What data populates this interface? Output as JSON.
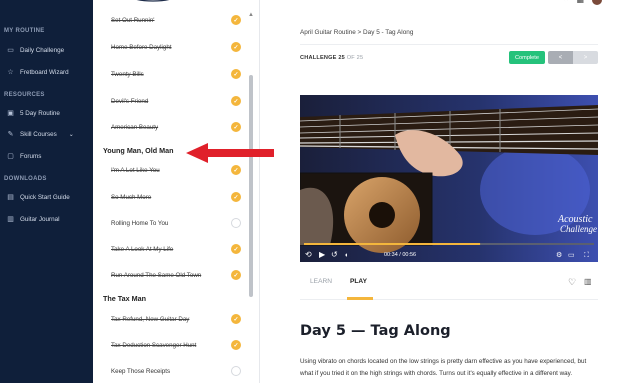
{
  "nav": {
    "sections": [
      {
        "label": "MY ROUTINE"
      },
      {
        "label": "RESOURCES"
      },
      {
        "label": "DOWNLOADS"
      }
    ],
    "items": [
      {
        "label": "Daily Challenge",
        "icon": "challenge-icon"
      },
      {
        "label": "Fretboard Wizard",
        "icon": "star-icon"
      },
      {
        "label": "5 Day Routine",
        "icon": "calendar-icon"
      },
      {
        "label": "Skill Courses",
        "icon": "courses-icon"
      },
      {
        "label": "Forums",
        "icon": "forum-icon"
      },
      {
        "label": "Quick Start Guide",
        "icon": "book-icon"
      },
      {
        "label": "Guitar Journal",
        "icon": "journal-icon"
      }
    ]
  },
  "lessons": {
    "items": [
      {
        "label": "Set Out Runnin'",
        "done": true
      },
      {
        "label": "Home Before Daylight",
        "done": true
      },
      {
        "label": "Twenty Bills",
        "done": true
      },
      {
        "label": "Devil's Friend",
        "done": true
      },
      {
        "label": "American Beauty",
        "done": true
      },
      {
        "label": "I'm A Lot Like You",
        "done": true
      },
      {
        "label": "So Much More",
        "done": true
      },
      {
        "label": "Rolling Home To You",
        "done": false
      },
      {
        "label": "Take A Look At My Life",
        "done": true
      },
      {
        "label": "Run Around The Same Old Town",
        "done": true
      },
      {
        "label": "Tax Refund, New Guitar Day",
        "done": true
      },
      {
        "label": "Tax Deduction Scavenger Hunt",
        "done": true
      },
      {
        "label": "Keep Those Receipts",
        "done": false
      }
    ],
    "groups": [
      {
        "label": "Young Man, Old Man"
      },
      {
        "label": "The Tax Man"
      }
    ]
  },
  "main": {
    "breadcrumb": "April Guitar Routine  >  Day 5 - Tag Along",
    "challenge_label": "CHALLENGE 25",
    "challenge_of": " OF 25",
    "complete_label": "Complete",
    "prev_label": "<",
    "next_label": ">",
    "video_time": "00:34 / 00:56",
    "video_watermark_1": "Acoustic",
    "video_watermark_2": "Challenge",
    "tabs": [
      {
        "label": "LEARN"
      },
      {
        "label": "PLAY"
      }
    ],
    "title": "Day 5 — Tag Along",
    "body_line1": "Using vibrato on chords located on the low strings is pretty darn effective as you have experienced, but",
    "body_line2": "what if you tried it on the high strings with chords. Turns out it's equally effective in a different way."
  },
  "colors": {
    "nav_bg": "#0f1f3a",
    "accent": "#f4b63c",
    "complete": "#25c27b",
    "arrow": "#e0202a"
  }
}
